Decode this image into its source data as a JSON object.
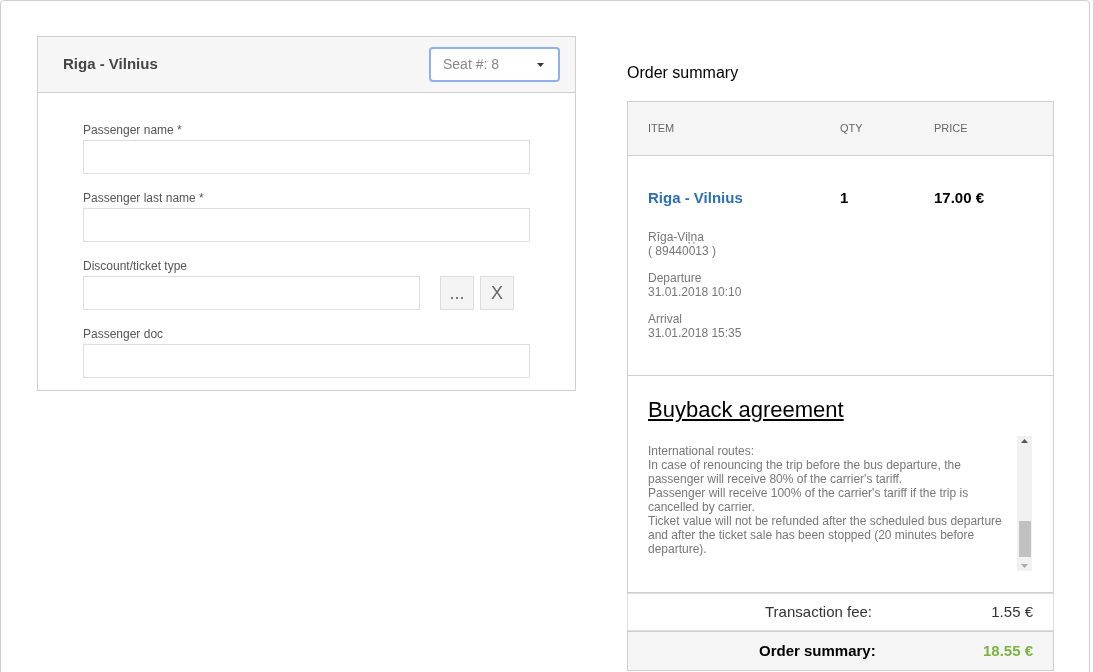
{
  "trip_card": {
    "title": "Riga - Vilnius",
    "seat_select": {
      "value": "Seat #: 8"
    },
    "fields": [
      {
        "kind": "text",
        "label": "Passenger name",
        "required_mark": "*"
      },
      {
        "kind": "text",
        "label": "Passenger last name",
        "required_mark": "*"
      },
      {
        "kind": "picker",
        "label": "Discount/ticket type",
        "buttons": [
          "...",
          "X"
        ]
      },
      {
        "kind": "text",
        "label": "Passenger doc"
      }
    ]
  },
  "order_summary": {
    "title": "Order summary",
    "columns": [
      "ITEM",
      "QTY",
      "PRICE"
    ],
    "item": {
      "name": "Riga - Vilnius",
      "qty": "1",
      "price": "17.00 €",
      "route": "Rīga-Viļņa",
      "route_code": "( 89440013 )",
      "details": [
        {
          "label": "Departure",
          "value": "31.01.2018 10:10"
        },
        {
          "label": "Arrival",
          "value": "31.01.2018 15:35"
        }
      ]
    },
    "agreement": {
      "title": "Buyback agreement",
      "paragraphs": [
        "International routes:",
        "In case of renouncing the trip before the bus departure, the passenger will receive 80% of the carrier's tariff.",
        "Passenger will receive 100% of the carrier's tariff if the trip is cancelled by carrier.",
        "Ticket value will not be refunded after the scheduled bus departure and after the ticket sale has been stopped (20 minutes before departure)."
      ]
    },
    "fee": {
      "label": "Transaction fee:",
      "value": "1.55 €"
    },
    "total": {
      "label": "Order summary:",
      "value": "18.55 €"
    }
  }
}
